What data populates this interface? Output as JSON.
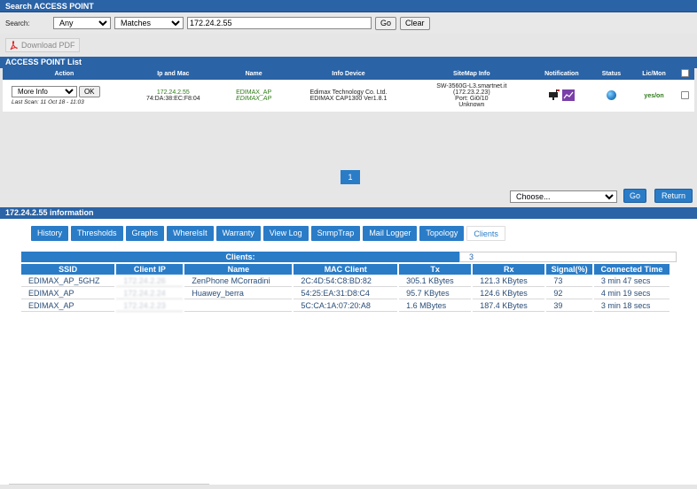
{
  "search": {
    "title": "Search ACCESS POINT",
    "label": "Search:",
    "field_value": "Any",
    "match_value": "Matches",
    "query": "172.24.2.55",
    "go": "Go",
    "clear": "Clear"
  },
  "download_pdf": "Download PDF",
  "list": {
    "title": "ACCESS POINT List",
    "columns": [
      "Action",
      "Ip and Mac",
      "Name",
      "Info Device",
      "SiteMap Info",
      "Notification",
      "Status",
      "Lic/Mon"
    ],
    "row": {
      "action_value": "More Info",
      "ok": "OK",
      "last_scan": "Last Scan: 11 Oct 18 - 11:03",
      "ip": "172.24.2.55",
      "mac": "74:DA:38:EC:F8:04",
      "name1": "EDIMAX_AP",
      "name2": "EDIMAX_AP",
      "device1": "Edimax Technology Co. Ltd.",
      "device2": "EDIMAX CAP1300 Ver1.8.1",
      "site1": "SW-3560G-L3.smartnet.it",
      "site2": "(172.23.2.23)",
      "site3": "Port: Gi0/10",
      "site4": "Unknown",
      "lic": "yes/on"
    }
  },
  "pager": {
    "page": "1"
  },
  "actions": {
    "choose": "Choose...",
    "go": "Go",
    "return": "Return"
  },
  "info": {
    "title": "172.24.2.55 information",
    "tabs": [
      "History",
      "Thresholds",
      "Graphs",
      "WhereIsIt",
      "Warranty",
      "View Log",
      "SnmpTrap",
      "Mail Logger",
      "Topology",
      "Clients"
    ],
    "active_tab": "Clients"
  },
  "clients": {
    "label": "Clients:",
    "count": "3",
    "columns": [
      "SSID",
      "Client IP",
      "Name",
      "MAC Client",
      "Tx",
      "Rx",
      "Signal(%)",
      "Connected Time"
    ],
    "rows": [
      [
        "EDIMAX_AP_5GHZ",
        "172.24.2.26",
        "ZenPhone MCorradini",
        "2C:4D:54:C8:BD:82",
        "305.1 KBytes",
        "121.3 KBytes",
        "73",
        "3 min 47 secs"
      ],
      [
        "EDIMAX_AP",
        "172.24.2.24",
        "Huawey_berra",
        "54:25:EA:31:D8:C4",
        "95.7 KBytes",
        "124.6 KBytes",
        "92",
        "4 min 19 secs"
      ],
      [
        "EDIMAX_AP",
        "172.24.2.23",
        "",
        "5C:CA:1A:07:20:A8",
        "1.6 MBytes",
        "187.4 KBytes",
        "39",
        "3 min 18 secs"
      ]
    ]
  }
}
